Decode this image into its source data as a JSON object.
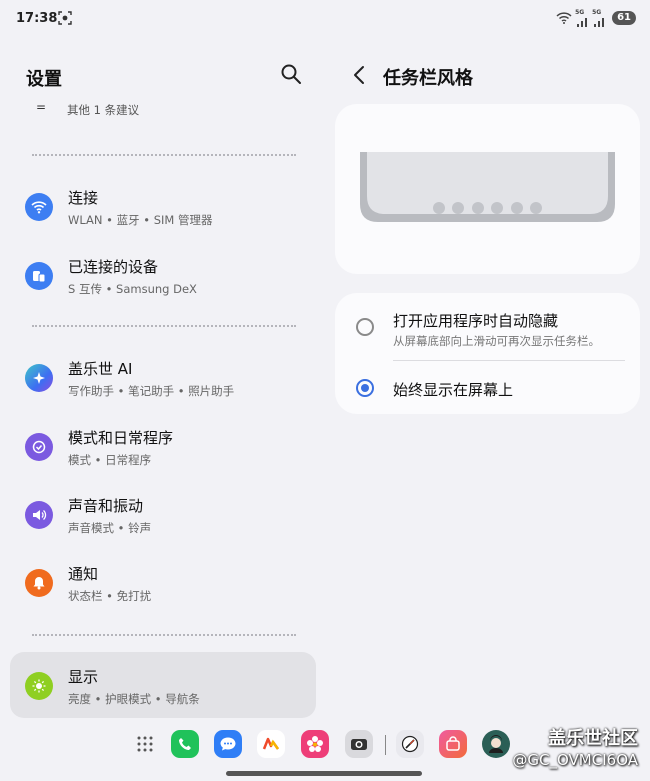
{
  "status_bar": {
    "time": "17:38",
    "net1": "5G",
    "net2": "5G",
    "battery": "61"
  },
  "settings": {
    "title": "设置",
    "suggestion": "其他 1 条建议",
    "items": [
      {
        "id": "connections",
        "title": "连接",
        "subtitle": "WLAN  •  蓝牙  •  SIM 管理器",
        "color": "#3d7ef2",
        "icon": "wifi-icon"
      },
      {
        "id": "connected-devices",
        "title": "已连接的设备",
        "subtitle": "S 互传  •  Samsung DeX",
        "color": "#3d7ef2",
        "icon": "devices-icon"
      },
      {
        "id": "galaxy-ai",
        "title": "盖乐世 AI",
        "subtitle": "写作助手  •  笔记助手  •  照片助手",
        "color": "#3fb0c8",
        "icon": "sparkle-icon"
      },
      {
        "id": "modes",
        "title": "模式和日常程序",
        "subtitle": "模式  •  日常程序",
        "color": "#7b5ae0",
        "icon": "check-circle-icon"
      },
      {
        "id": "sounds",
        "title": "声音和振动",
        "subtitle": "声音模式  •  铃声",
        "color": "#7b5ae0",
        "icon": "speaker-icon"
      },
      {
        "id": "notifications",
        "title": "通知",
        "subtitle": "状态栏  •  免打扰",
        "color": "#f06b1e",
        "icon": "bell-icon"
      },
      {
        "id": "display",
        "title": "显示",
        "subtitle": "亮度  •  护眼模式  •  导航条",
        "color": "#8fcf22",
        "icon": "sun-icon"
      }
    ]
  },
  "taskbar": {
    "title": "任务栏风格",
    "options": [
      {
        "title": "打开应用程序时自动隐藏",
        "subtitle": "从屏幕底部向上滑动可再次显示任务栏。",
        "selected": false
      },
      {
        "title": "始终显示在屏幕上",
        "subtitle": "",
        "selected": true
      }
    ]
  },
  "dock": {
    "apps": [
      "apps-grid-icon",
      "phone-icon",
      "messages-icon",
      "app-store-icon",
      "gallery-icon",
      "camera-icon",
      "clock-icon",
      "shop-icon",
      "avatar-icon"
    ]
  },
  "watermark": {
    "line1": "盖乐世社区",
    "line2": "@GC_OVMCI6OA"
  }
}
